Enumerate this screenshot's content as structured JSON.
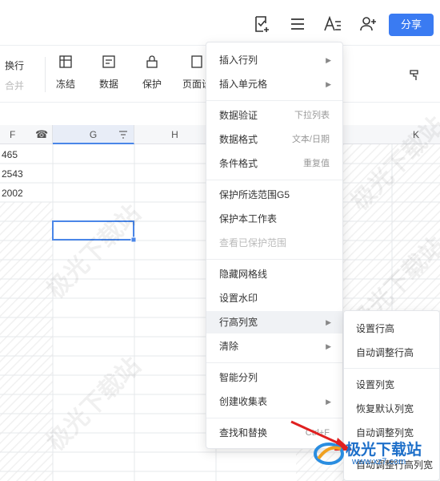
{
  "toolbar": {
    "share_label": "分享",
    "icons": [
      "checklist-icon",
      "menu-icon",
      "text-format-icon",
      "add-user-icon"
    ]
  },
  "ribbon": {
    "wrap_label": "换行",
    "merge_label": "合并",
    "freeze_label": "冻结",
    "data_label": "数据",
    "protect_label": "保护",
    "page_label": "页面设"
  },
  "columns": [
    "F",
    "G",
    "H",
    "K"
  ],
  "cells": [
    "465",
    "2543",
    "2002"
  ],
  "menu": {
    "items": [
      {
        "label": "插入行列",
        "hint": "",
        "arrow": true
      },
      {
        "label": "插入单元格",
        "hint": "",
        "arrow": true
      },
      {
        "label": "数据验证",
        "hint": "下拉列表",
        "arrow": false
      },
      {
        "label": "数据格式",
        "hint": "文本/日期",
        "arrow": false
      },
      {
        "label": "条件格式",
        "hint": "重复值",
        "arrow": false
      },
      {
        "label": "保护所选范围G5",
        "hint": "",
        "arrow": false
      },
      {
        "label": "保护本工作表",
        "hint": "",
        "arrow": false
      },
      {
        "label": "查看已保护范围",
        "hint": "",
        "arrow": false
      },
      {
        "label": "隐藏网格线",
        "hint": "",
        "arrow": false
      },
      {
        "label": "设置水印",
        "hint": "",
        "arrow": false
      },
      {
        "label": "行高列宽",
        "hint": "",
        "arrow": true
      },
      {
        "label": "清除",
        "hint": "",
        "arrow": true
      },
      {
        "label": "智能分列",
        "hint": "",
        "arrow": false
      },
      {
        "label": "创建收集表",
        "hint": "",
        "arrow": true
      },
      {
        "label": "查找和替换",
        "hint": "Ctrl+F",
        "arrow": false
      }
    ]
  },
  "submenu": {
    "items": [
      "设置行高",
      "自动调整行高",
      "设置列宽",
      "恢复默认列宽",
      "自动调整列宽",
      "自动调整行高列宽"
    ]
  },
  "watermark": {
    "text": "极光下载站",
    "logo_text": "极光下载站",
    "logo_url": "www.xz7.com"
  },
  "colors": {
    "accent": "#3a7bf2",
    "selection": "#4a86e8"
  }
}
